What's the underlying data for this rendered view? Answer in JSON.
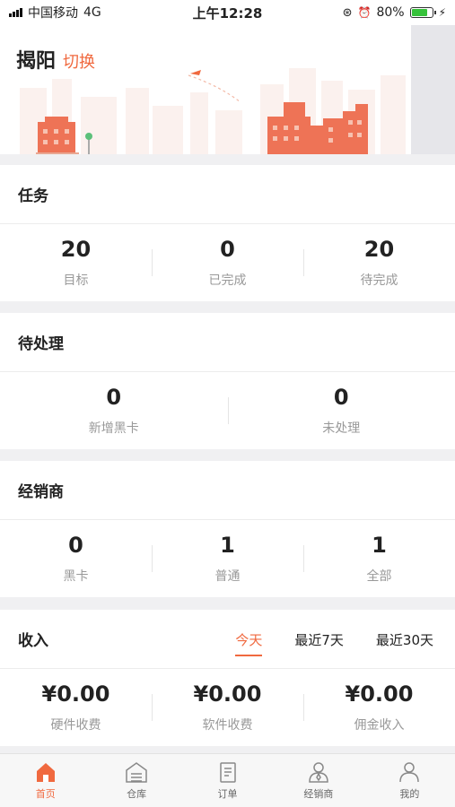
{
  "status_bar": {
    "carrier": "中国移动",
    "network": "4G",
    "time": "上午12:28",
    "battery": "80%",
    "battery_level": 0.8
  },
  "header": {
    "city": "揭阳",
    "switch_label": "切换"
  },
  "tasks": {
    "title": "任务",
    "stats": [
      {
        "value": "20",
        "label": "目标"
      },
      {
        "value": "0",
        "label": "已完成"
      },
      {
        "value": "20",
        "label": "待完成"
      }
    ]
  },
  "pending": {
    "title": "待处理",
    "stats": [
      {
        "value": "0",
        "label": "新增黑卡"
      },
      {
        "value": "0",
        "label": "未处理"
      }
    ]
  },
  "dealers": {
    "title": "经销商",
    "stats": [
      {
        "value": "0",
        "label": "黑卡"
      },
      {
        "value": "1",
        "label": "普通"
      },
      {
        "value": "1",
        "label": "全部"
      }
    ]
  },
  "income": {
    "title": "收入",
    "tabs": [
      "今天",
      "最近7天",
      "最近30天"
    ],
    "active_tab": "今天",
    "stats": [
      {
        "value": "¥0.00",
        "label": "硬件收费"
      },
      {
        "value": "¥0.00",
        "label": "软件收费"
      },
      {
        "value": "¥0.00",
        "label": "佣金收入"
      }
    ]
  },
  "tabbar": {
    "items": [
      {
        "label": "首页",
        "icon": "home-icon"
      },
      {
        "label": "仓库",
        "icon": "warehouse-icon"
      },
      {
        "label": "订单",
        "icon": "order-icon"
      },
      {
        "label": "经销商",
        "icon": "dealer-icon"
      },
      {
        "label": "我的",
        "icon": "profile-icon"
      }
    ],
    "active": "首页"
  },
  "colors": {
    "accent": "#f0693f",
    "building": "#ee7356",
    "background": "#f0f0f2"
  }
}
